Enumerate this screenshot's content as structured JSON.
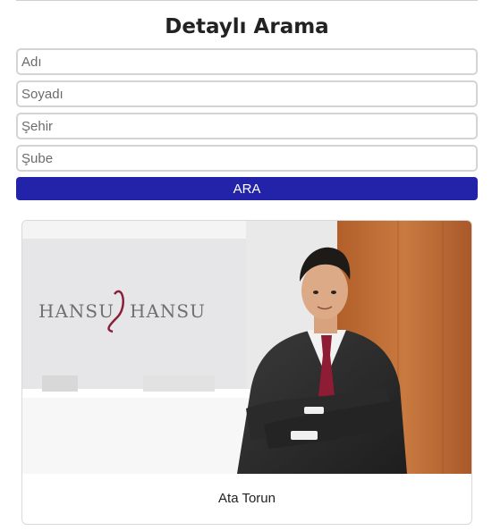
{
  "page": {
    "title": "Detaylı Arama"
  },
  "search": {
    "first_name_placeholder": "Adı",
    "last_name_placeholder": "Soyadı",
    "city_placeholder": "Şehir",
    "branch_placeholder": "Şube",
    "submit_label": "ARA"
  },
  "results": [
    {
      "name": "Ata Torun",
      "photo_logo_text": "HANSU HANSU"
    }
  ],
  "colors": {
    "button_bg": "#2223a8",
    "button_text": "#ffffff",
    "field_border": "#d4d4d4"
  }
}
